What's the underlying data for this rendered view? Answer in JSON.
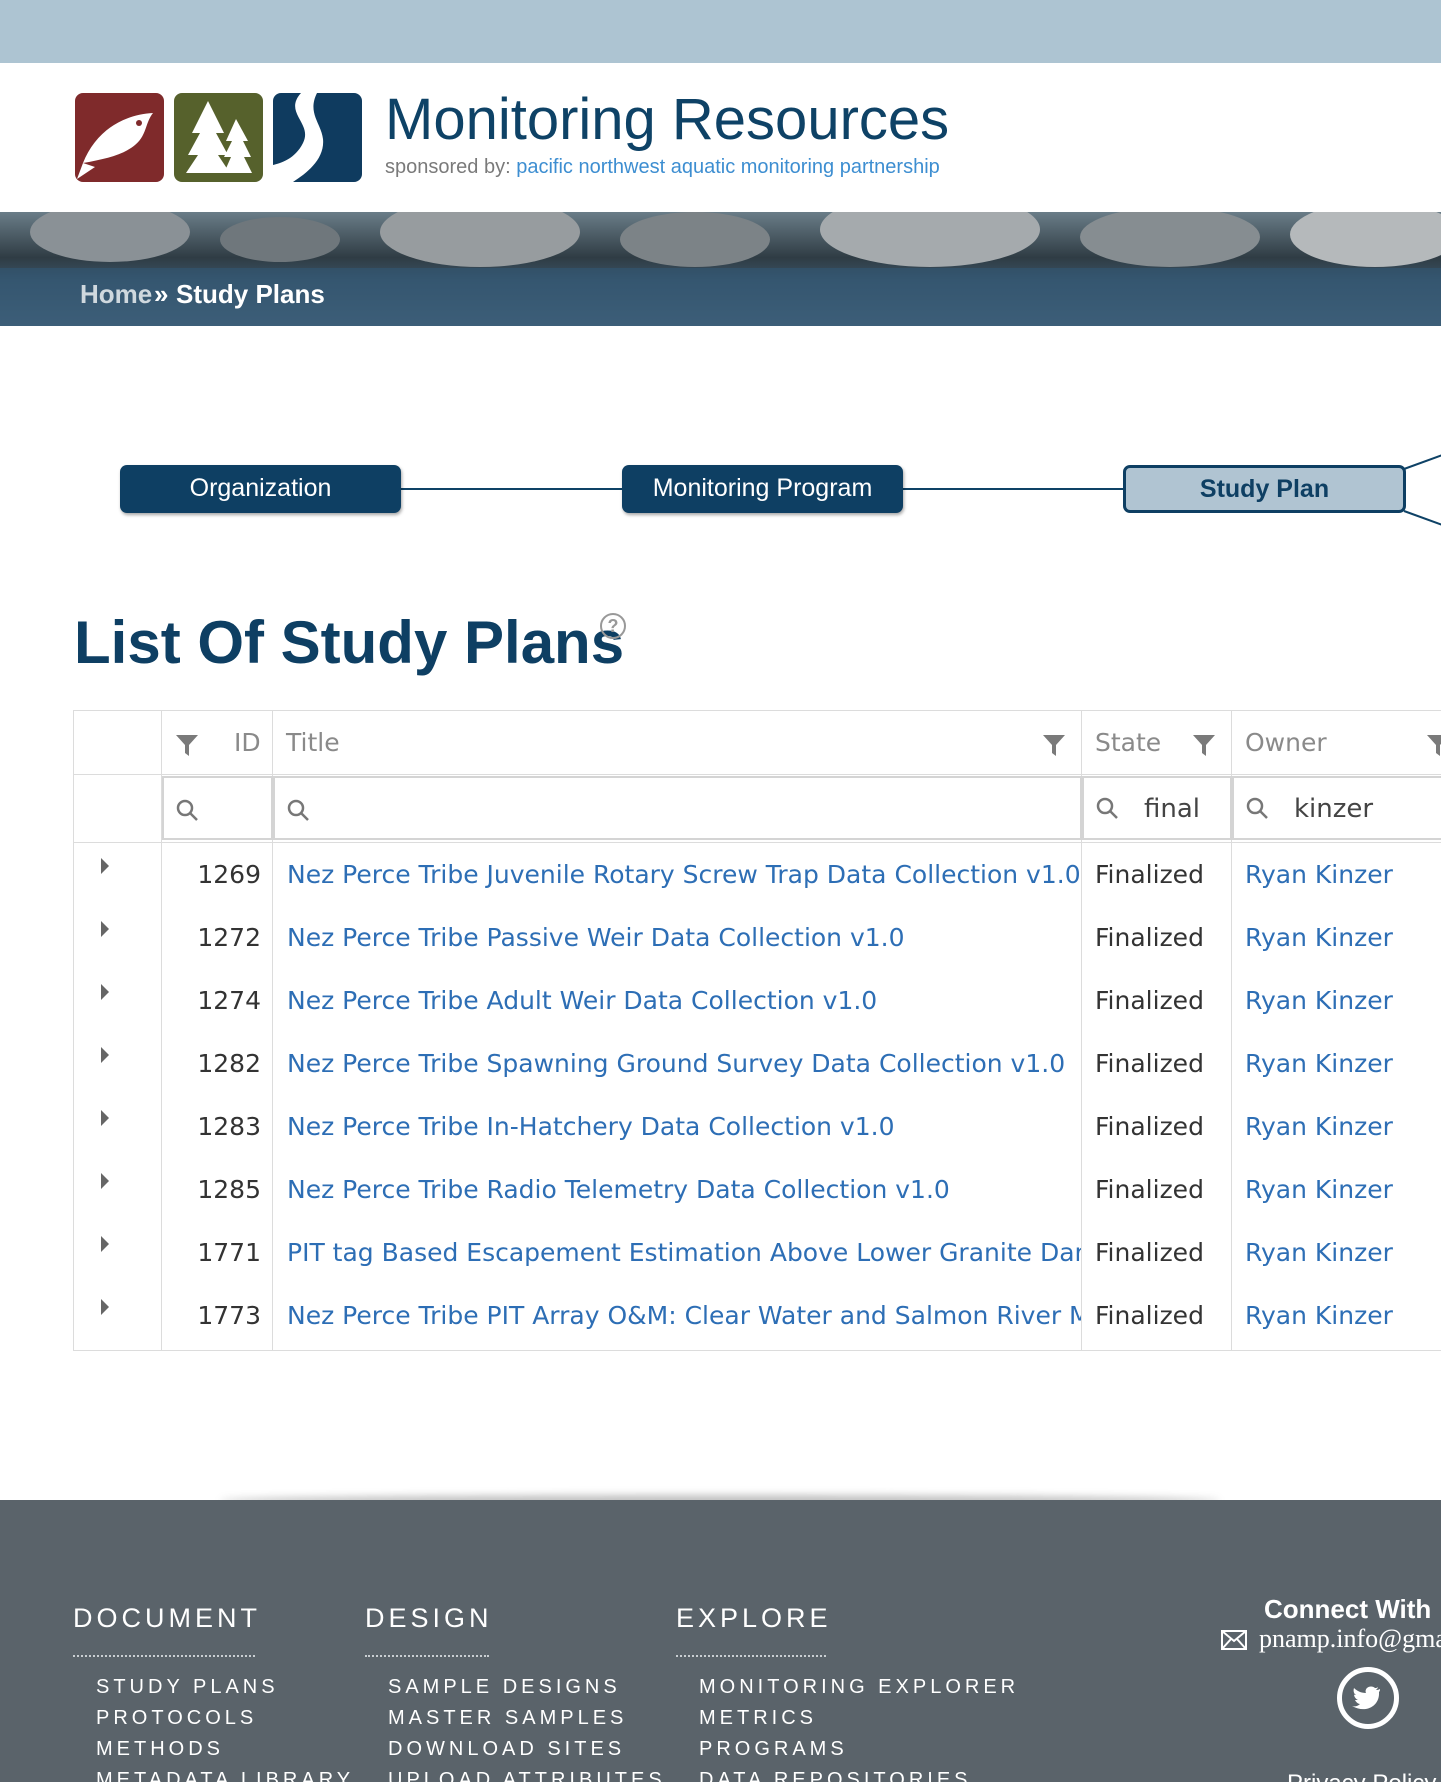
{
  "site": {
    "title": "Monitoring Resources",
    "sponsor_prefix": "sponsored by:",
    "sponsor_name": "pacific northwest aquatic monitoring partnership"
  },
  "breadcrumb": {
    "home": "Home",
    "separator": "»",
    "current": "Study Plans"
  },
  "workflow": {
    "nodes": [
      "Organization",
      "Monitoring Program",
      "Study Plan"
    ],
    "active": "Study Plan"
  },
  "page": {
    "heading": "List Of Study Plans",
    "help_icon": "question-circle-icon"
  },
  "grid": {
    "columns": [
      "ID",
      "Title",
      "State",
      "Owner"
    ],
    "filters": {
      "id": "",
      "title": "",
      "state": "final",
      "owner": "kinzer"
    },
    "rows": [
      {
        "id": "1269",
        "title": "Nez Perce Tribe Juvenile Rotary Screw Trap Data Collection v1.0",
        "state": "Finalized",
        "owner": "Ryan Kinzer"
      },
      {
        "id": "1272",
        "title": "Nez Perce Tribe Passive Weir Data Collection v1.0",
        "state": "Finalized",
        "owner": "Ryan Kinzer"
      },
      {
        "id": "1274",
        "title": "Nez Perce Tribe Adult Weir Data Collection v1.0",
        "state": "Finalized",
        "owner": "Ryan Kinzer"
      },
      {
        "id": "1282",
        "title": "Nez Perce Tribe Spawning Ground Survey Data Collection v1.0",
        "state": "Finalized",
        "owner": "Ryan Kinzer"
      },
      {
        "id": "1283",
        "title": "Nez Perce Tribe In-Hatchery Data Collection v1.0",
        "state": "Finalized",
        "owner": "Ryan Kinzer"
      },
      {
        "id": "1285",
        "title": "Nez Perce Tribe Radio Telemetry Data Collection v1.0",
        "state": "Finalized",
        "owner": "Ryan Kinzer"
      },
      {
        "id": "1771",
        "title": "PIT tag Based Escapement Estimation Above Lower Granite Dam DABOM",
        "state": "Finalized",
        "owner": "Ryan Kinzer"
      },
      {
        "id": "1773",
        "title": "Nez Perce Tribe PIT Array O&M: Clear Water and Salmon River MSA's",
        "state": "Finalized",
        "owner": "Ryan Kinzer"
      }
    ]
  },
  "footer": {
    "columns": [
      {
        "heading": "DOCUMENT",
        "links": [
          "STUDY PLANS",
          "PROTOCOLS",
          "METHODS",
          "METADATA LIBRARY"
        ]
      },
      {
        "heading": "DESIGN",
        "links": [
          "SAMPLE DESIGNS",
          "MASTER SAMPLES",
          "DOWNLOAD SITES",
          "UPLOAD ATTRIBUTES"
        ]
      },
      {
        "heading": "EXPLORE",
        "links": [
          "MONITORING EXPLORER",
          "METRICS",
          "PROGRAMS",
          "DATA REPOSITORIES"
        ]
      }
    ],
    "connect_title": "Connect With",
    "email": "pnamp.info@gmail.com",
    "privacy": "Privacy Policy"
  },
  "colors": {
    "topbar": "#adc4d2",
    "brand_navy": "#0e3f63",
    "link_blue": "#2d6eb5",
    "footer_bg": "#5a636a"
  }
}
